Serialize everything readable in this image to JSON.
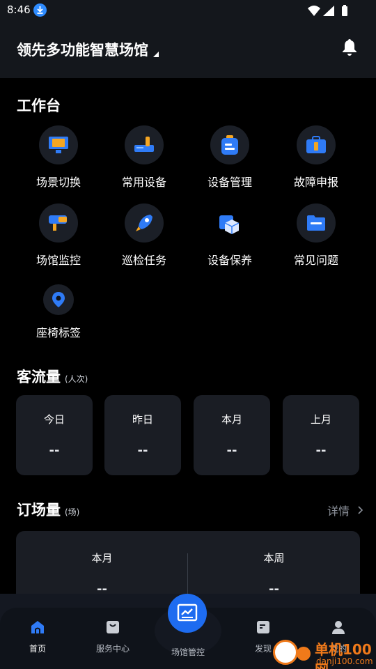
{
  "status_bar": {
    "time": "8:46",
    "icons": [
      "download-icon",
      "wifi-icon",
      "signal-icon",
      "battery-icon"
    ]
  },
  "header": {
    "title": "领先多功能智慧场馆",
    "bell_icon": "bell-icon"
  },
  "workbench": {
    "title": "工作台",
    "items": [
      {
        "label": "场景切换",
        "icon": "scene-switch-icon"
      },
      {
        "label": "常用设备",
        "icon": "common-device-icon"
      },
      {
        "label": "设备管理",
        "icon": "device-manage-icon"
      },
      {
        "label": "故障申报",
        "icon": "fault-report-icon"
      },
      {
        "label": "场馆监控",
        "icon": "monitor-camera-icon"
      },
      {
        "label": "巡检任务",
        "icon": "inspection-rocket-icon"
      },
      {
        "label": "设备保养",
        "icon": "maintenance-cube-icon"
      },
      {
        "label": "常见问题",
        "icon": "faq-folder-icon"
      },
      {
        "label": "座椅标签",
        "icon": "seat-pin-icon"
      }
    ]
  },
  "traffic": {
    "title": "客流量",
    "unit": "(人次)",
    "cards": [
      {
        "label": "今日",
        "value": "--"
      },
      {
        "label": "昨日",
        "value": "--"
      },
      {
        "label": "本月",
        "value": "--"
      },
      {
        "label": "上月",
        "value": "--"
      }
    ]
  },
  "bookings": {
    "title": "订场量",
    "unit": "(场)",
    "detail_label": "详情",
    "cards": [
      {
        "label": "本月",
        "value": "--"
      },
      {
        "label": "本周",
        "value": "--"
      }
    ]
  },
  "tabbar": {
    "tabs": [
      {
        "label": "首页",
        "icon": "home-icon",
        "active": true
      },
      {
        "label": "服务中心",
        "icon": "bag-icon",
        "active": false
      },
      {
        "label": "场馆管控",
        "icon": "venue-control-icon",
        "active": false
      },
      {
        "label": "发现",
        "icon": "discover-icon",
        "active": false
      },
      {
        "label": "我的",
        "icon": "profile-icon",
        "active": false
      }
    ]
  },
  "watermark": {
    "name": "单机100网",
    "url": "danji100.com"
  },
  "colors": {
    "accent": "#1e6cf0",
    "card_bg": "#1a1d24",
    "header_bg": "#14171c",
    "watermark": "#f07a1a"
  }
}
